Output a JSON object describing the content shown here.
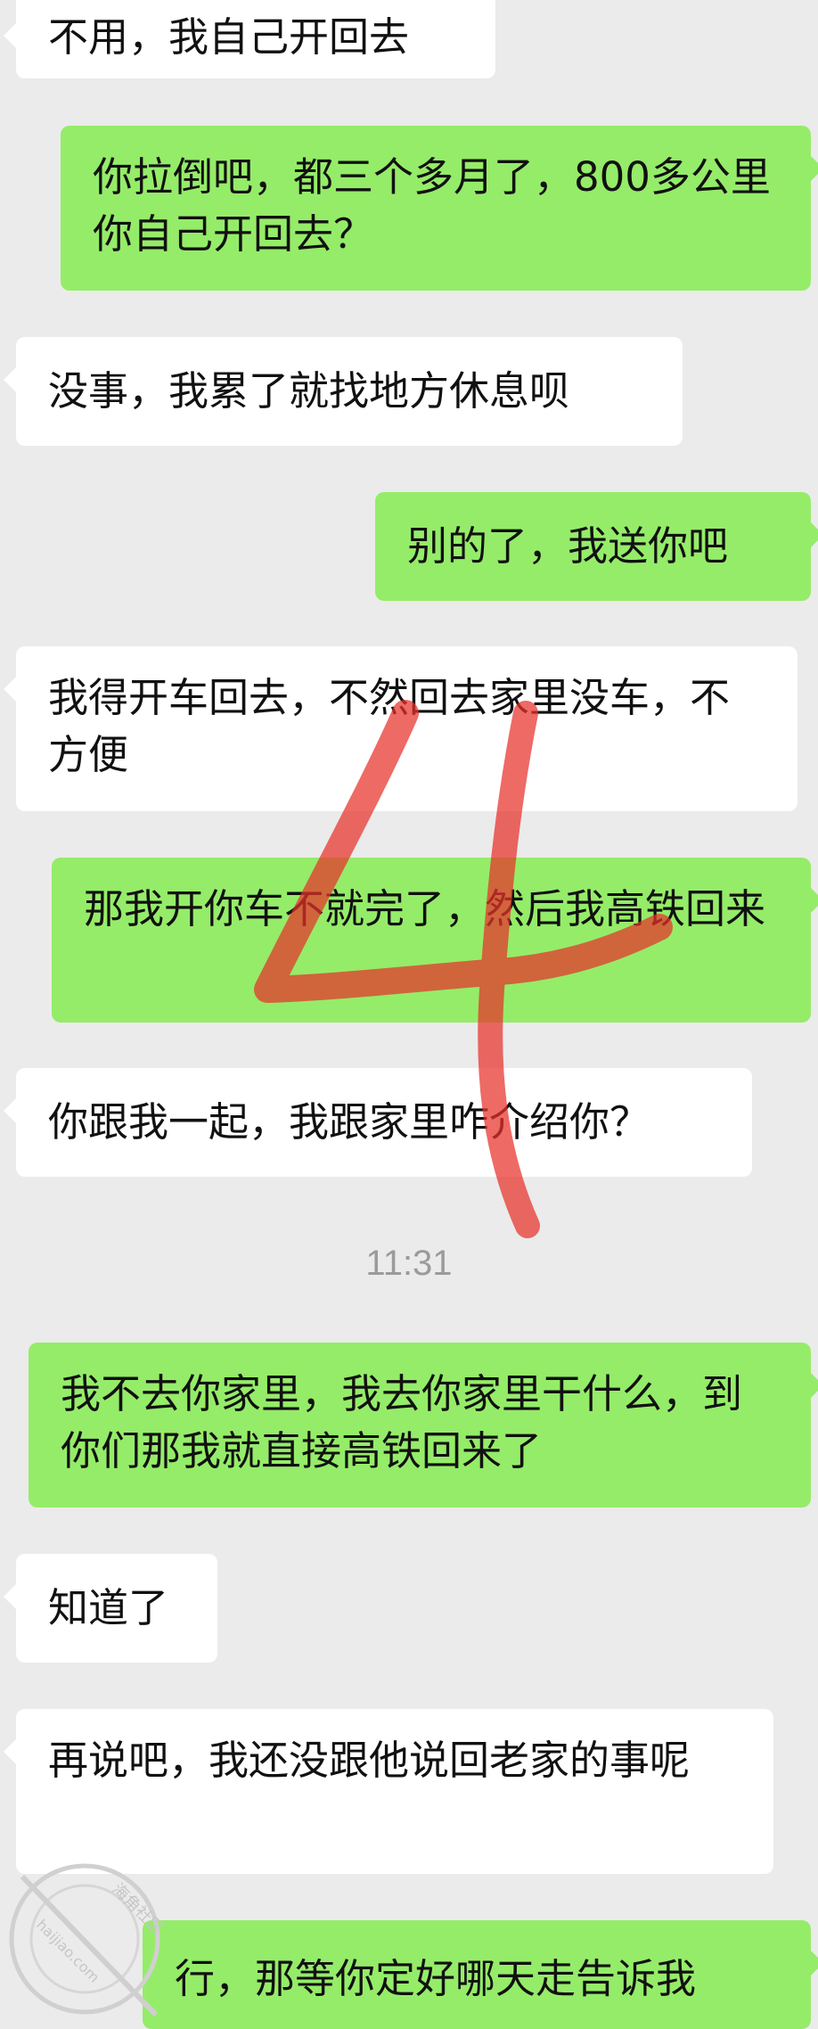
{
  "messages": [
    {
      "side": "in",
      "text": "不用，我自己开回去"
    },
    {
      "side": "out",
      "text": "你拉倒吧，都三个多月了，800多公里你自己开回去？"
    },
    {
      "side": "in",
      "text": "没事，我累了就找地方休息呗"
    },
    {
      "side": "out",
      "text": "别的了，我送你吧"
    },
    {
      "side": "in",
      "text": "我得开车回去，不然回去家里没车，不方便"
    },
    {
      "side": "out",
      "text": "那我开你车不就完了，然后我高铁回来"
    },
    {
      "side": "in",
      "text": "你跟我一起，我跟家里咋介绍你？"
    },
    {
      "side": "out",
      "text": "我不去你家里，我去你家里干什么，到你们那我就直接高铁回来了"
    },
    {
      "side": "in",
      "text": "知道了"
    },
    {
      "side": "in",
      "text": "再说吧，我还没跟他说回老家的事呢"
    },
    {
      "side": "out",
      "text": "行，那等你定好哪天走告诉我"
    }
  ],
  "timestamp": "11:31",
  "annotation": {
    "mark": "4",
    "color": "#e8312a"
  },
  "watermark": {
    "line1": "海角社区",
    "line2": "haijiao.com"
  },
  "colors": {
    "background": "#ebebeb",
    "incoming": "#ffffff",
    "outgoing": "#95ec69",
    "text": "#111111"
  }
}
